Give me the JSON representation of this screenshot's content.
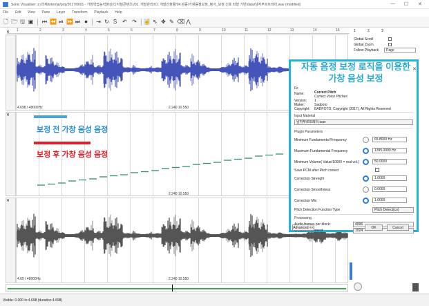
{
  "window": {
    "title": "Sonic Visualiser: z:/과제/internal/proj/2017/0601 - 가창학습능력향상(디지털콘텐츠)/01. 개발관리/01. 개발산출물/04.검증/가창음정보정_평가_보정 신호 파형 기반/data/남자부르트레이.wav (modified)",
    "controls": [
      "—",
      "☐",
      "✕"
    ]
  },
  "menu": [
    "File",
    "Edit",
    "View",
    "Pane",
    "Layer",
    "Transform",
    "Playback",
    "Help"
  ],
  "ruler": {
    "ticks": [
      "1",
      "2",
      "3",
      "4",
      "5",
      "6",
      "7",
      "8",
      "9",
      "10",
      "11",
      "12",
      "13",
      "14",
      "15"
    ]
  },
  "panes": {
    "top": {
      "samplerate": "4.698 / 48000Hz",
      "center": "2.240 10.550"
    },
    "middle": {
      "center": "2.240 10.550"
    },
    "bottom": {
      "samplerate": "4.65 / 48000Hz",
      "center": "2.240 10.550"
    }
  },
  "right_panel": {
    "tabs": [
      "1",
      "2",
      "3"
    ],
    "global_scroll": "Global Scroll",
    "global_zoom": "Global Zoom",
    "follow_playback": "Follow Playback",
    "follow_value": "Page"
  },
  "annotations": {
    "dialog_caption": "자동 음정 보정 로직을 이용한 가창 음성 보정",
    "before_label": "보정 전 가창 음성 음정",
    "after_label": "보정 후 가창 음성 음정",
    "before_color": "#4da3d8",
    "after_color": "#e0202a"
  },
  "plugin": {
    "feature_label": "Fe",
    "name_label": "Name:",
    "name_value": "Correct Pitch",
    "subtitle": "Correct Voice Pitches",
    "version_label": "Version:",
    "version_value": "1",
    "maker_label": "Maker:",
    "maker_value": "Sadpoto",
    "copyright_label": "Copyright:",
    "copyright_value": "BADPOTO, Copyright (2017), All Rights Reserved",
    "input_material": "Input Material",
    "input_file": "남자부르트레이.wav",
    "params_title": "Plugin Parameters",
    "params": [
      {
        "label": "Minimum Fundamental Frequency",
        "value": "65.8000 Hz"
      },
      {
        "label": "Maximum Fundamental Frequency",
        "value": "1395.0000 Hz"
      },
      {
        "label": "Minimum Volume( Value/10000 = real vol.)",
        "value": "50.0000"
      },
      {
        "label": "Save PCM after Pitch correct",
        "value": ""
      },
      {
        "label": "Correction Strength",
        "value": "1.0000"
      },
      {
        "label": "Correction Smoothness",
        "value": "0.0000"
      },
      {
        "label": "Correction Mix",
        "value": "1.0000"
      },
      {
        "label": "Pitch Detection Function Type",
        "value": "Pitch Detect(co)"
      }
    ],
    "processing_title": "Processing",
    "block_label": "Audio frames per block:",
    "block_value": "4096",
    "window_label": "Window increment:",
    "window_value": "1024",
    "advanced": "Advanced <<",
    "ok": "OK",
    "cancel": "Cancel"
  },
  "statusbar": {
    "text": "Visible: 0.000 to 4.698 (duration 4.698)"
  }
}
